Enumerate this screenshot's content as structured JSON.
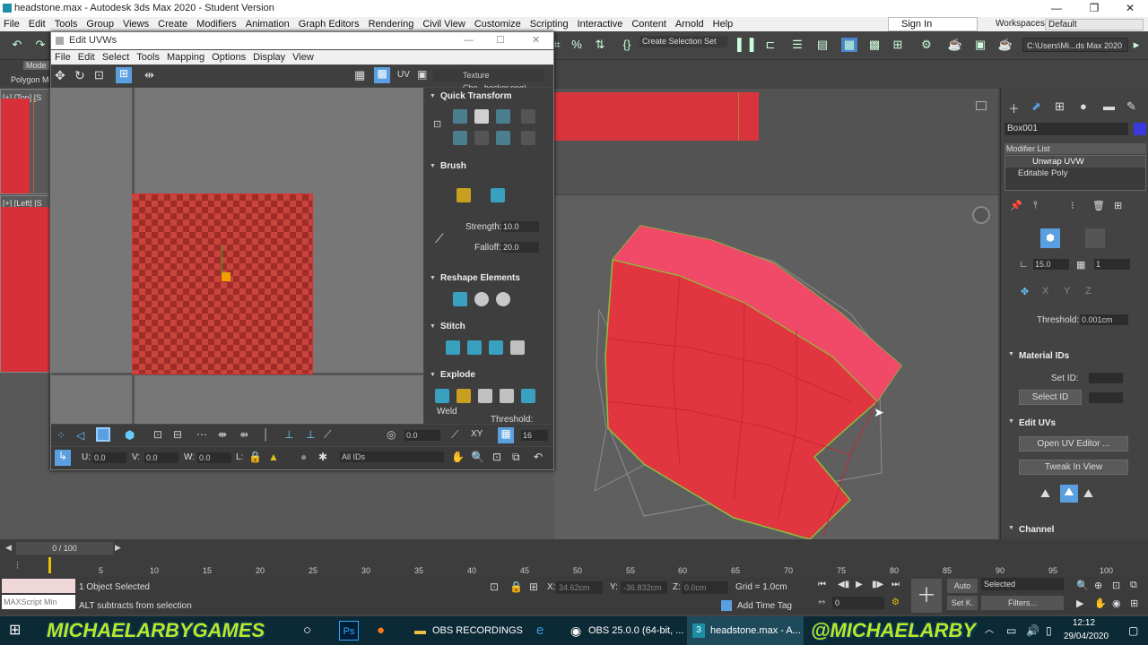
{
  "window": {
    "title": "headstone.max - Autodesk 3ds Max 2020 - Student Version",
    "minimize": "—",
    "maximize": "❐",
    "close": "✕"
  },
  "menu": [
    "File",
    "Edit",
    "Tools",
    "Group",
    "Views",
    "Create",
    "Modifiers",
    "Animation",
    "Graph Editors",
    "Rendering",
    "Civil View",
    "Customize",
    "Scripting",
    "Interactive",
    "Content",
    "Arnold",
    "Help"
  ],
  "account": {
    "sign_in": "Sign In",
    "workspaces_label": "Workspaces:",
    "workspace": "Default"
  },
  "toolbar": {
    "selection_set": "Create Selection Set",
    "project_path": "C:\\Users\\Mi...ds Max 2020"
  },
  "ribbon": {
    "mode": "Mode",
    "polygon": "Polygon M"
  },
  "viewports": {
    "top": "[+] [Top] [S",
    "left": "[+] [Left] [S"
  },
  "uvw": {
    "title": "Edit UVWs",
    "menu": [
      "File",
      "Edit",
      "Select",
      "Tools",
      "Mapping",
      "Options",
      "Display",
      "View"
    ],
    "uv_label": "UV",
    "texture": "Texture Che...hecker.png)",
    "sections": {
      "quick_transform": "Quick Transform",
      "brush": "Brush",
      "reshape": "Reshape Elements",
      "stitch": "Stitch",
      "explode": "Explode"
    },
    "brush": {
      "strength_label": "Strength:",
      "strength": "10.0",
      "falloff_label": "Falloff:",
      "falloff": "20.0"
    },
    "explode": {
      "weld": "Weld",
      "threshold": "Threshold:"
    },
    "bottom": {
      "spin_value": "0.0",
      "xy": "XY",
      "grid": "16",
      "u_label": "U:",
      "u": "0.0",
      "v_label": "V:",
      "v": "0.0",
      "w_label": "W:",
      "w": "0.0",
      "l_label": "L:",
      "ids": "All IDs"
    }
  },
  "command_panel": {
    "object_name": "Box001",
    "modifier_list": "Modifier List",
    "stack": [
      "Unwrap UVW",
      "Editable Poly"
    ],
    "angle": "15.0",
    "count": "1",
    "threshold_label": "Threshold:",
    "threshold": "0.001cm",
    "material_ids": "Material IDs",
    "set_id_label": "Set ID:",
    "select_id": "Select ID",
    "edit_uvs": "Edit UVs",
    "open_uv_editor": "Open UV Editor ...",
    "tweak_in_view": "Tweak In View",
    "channel": "Channel"
  },
  "timeline": {
    "frame": "0 / 100",
    "ticks": [
      "5",
      "10",
      "15",
      "20",
      "25",
      "30",
      "35",
      "40",
      "45",
      "50",
      "55",
      "60",
      "65",
      "70",
      "75",
      "80",
      "85",
      "90",
      "95",
      "100"
    ]
  },
  "status": {
    "maxscript": "MAXScript Min",
    "selected": "1 Object Selected",
    "hint": "ALT subtracts from selection",
    "x_label": "X:",
    "x": "34.62cm",
    "y_label": "Y:",
    "y": "-36.832cm",
    "z_label": "Z:",
    "z": "0.0cm",
    "grid": "Grid = 1.0cm",
    "add_time_tag": "Add Time Tag",
    "auto": "Auto",
    "set_k": "Set K.",
    "selected_dd": "Selected",
    "filters": "Filters...",
    "frame_spin": "0"
  },
  "taskbar": {
    "brand_left": "MICHAELARBYGAMES",
    "brand_right": "@MICHAELARBY",
    "obs_folder": "OBS RECORDINGS",
    "obs_app": "OBS 25.0.0 (64-bit, ...",
    "max_app": "headstone.max - A...",
    "time": "12:12",
    "date": "29/04/2020"
  },
  "colors": {
    "model_red": "#e8303e",
    "uv_select": "#cc2a2a",
    "accent_blue": "#5aa0e0",
    "brand_green": "#b9e82a"
  }
}
